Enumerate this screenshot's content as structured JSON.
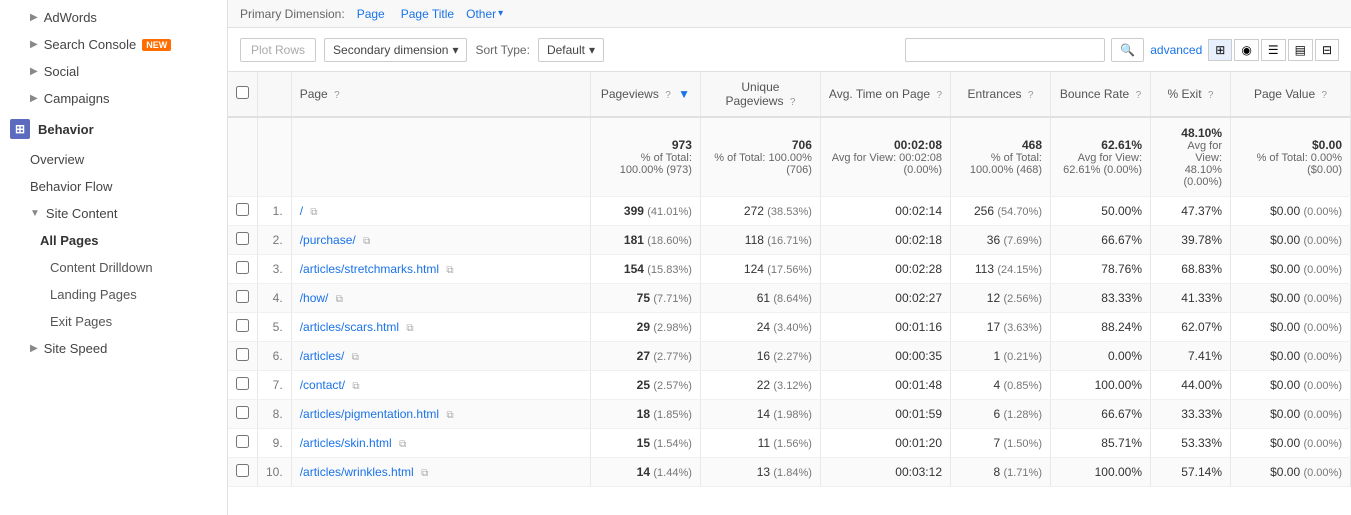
{
  "sidebar": {
    "items": [
      {
        "id": "adwords",
        "label": "AdWords",
        "arrow": "▶",
        "indent": 1
      },
      {
        "id": "search-console",
        "label": "Search Console",
        "badge": "NEW",
        "arrow": "▶",
        "indent": 1
      },
      {
        "id": "social",
        "label": "Social",
        "arrow": "▶",
        "indent": 1
      },
      {
        "id": "campaigns",
        "label": "Campaigns",
        "arrow": "▶",
        "indent": 1
      },
      {
        "id": "behavior",
        "label": "Behavior",
        "isSection": true
      },
      {
        "id": "overview",
        "label": "Overview",
        "indent": 1
      },
      {
        "id": "behavior-flow",
        "label": "Behavior Flow",
        "indent": 1
      },
      {
        "id": "site-content",
        "label": "Site Content",
        "arrow": "▼",
        "indent": 1
      },
      {
        "id": "all-pages",
        "label": "All Pages",
        "indent": 2,
        "active": true
      },
      {
        "id": "content-drilldown",
        "label": "Content Drilldown",
        "indent": 3
      },
      {
        "id": "landing-pages",
        "label": "Landing Pages",
        "indent": 3
      },
      {
        "id": "exit-pages",
        "label": "Exit Pages",
        "indent": 3
      },
      {
        "id": "site-speed",
        "label": "Site Speed",
        "arrow": "▶",
        "indent": 1
      }
    ]
  },
  "dimension_bar": {
    "label": "Primary Dimension:",
    "tabs": [
      {
        "id": "page",
        "label": "Page",
        "active": true
      },
      {
        "id": "page-title",
        "label": "Page Title"
      },
      {
        "id": "other",
        "label": "Other",
        "hasDropdown": true
      }
    ]
  },
  "toolbar": {
    "plot_rows_label": "Plot Rows",
    "secondary_dim_label": "Secondary dimension",
    "sort_type_label": "Sort Type:",
    "sort_default_label": "Default",
    "search_placeholder": "",
    "advanced_label": "advanced"
  },
  "summary": {
    "pageviews": "973",
    "pageviews_pct": "% of Total: 100.00% (973)",
    "unique_pageviews": "706",
    "unique_pct": "% of Total: 100.00% (706)",
    "avg_time": "00:02:08",
    "avg_time_sub": "Avg for View: 00:02:08 (0.00%)",
    "entrances": "468",
    "entrances_pct": "% of Total: 100.00% (468)",
    "bounce_rate": "62.61%",
    "bounce_sub": "Avg for View: 62.61% (0.00%)",
    "exit_pct": "48.10%",
    "exit_sub": "Avg for View: 48.10% (0.00%)",
    "page_value": "$0.00",
    "page_value_sub": "% of Total: 0.00% ($0.00)"
  },
  "table": {
    "headers": [
      {
        "id": "checkbox",
        "label": ""
      },
      {
        "id": "num",
        "label": ""
      },
      {
        "id": "page",
        "label": "Page"
      },
      {
        "id": "pageviews",
        "label": "Pageviews",
        "help": true,
        "sort": true
      },
      {
        "id": "unique-pageviews",
        "label": "Unique Pageviews",
        "help": true
      },
      {
        "id": "avg-time",
        "label": "Avg. Time on Page",
        "help": true
      },
      {
        "id": "entrances",
        "label": "Entrances",
        "help": true
      },
      {
        "id": "bounce-rate",
        "label": "Bounce Rate",
        "help": true
      },
      {
        "id": "exit",
        "label": "% Exit",
        "help": true
      },
      {
        "id": "page-value",
        "label": "Page Value",
        "help": true
      }
    ],
    "rows": [
      {
        "num": 1,
        "page": "/",
        "pageviews": "399",
        "pv_pct": "(41.01%)",
        "upv": "272",
        "upv_pct": "(38.53%)",
        "time": "00:02:14",
        "entrances": "256",
        "ent_pct": "(54.70%)",
        "bounce": "50.00%",
        "exit": "47.37%",
        "value": "$0.00",
        "val_pct": "(0.00%)"
      },
      {
        "num": 2,
        "page": "/purchase/",
        "pageviews": "181",
        "pv_pct": "(18.60%)",
        "upv": "118",
        "upv_pct": "(16.71%)",
        "time": "00:02:18",
        "entrances": "36",
        "ent_pct": "(7.69%)",
        "bounce": "66.67%",
        "exit": "39.78%",
        "value": "$0.00",
        "val_pct": "(0.00%)"
      },
      {
        "num": 3,
        "page": "/articles/stretchmarks.html",
        "pageviews": "154",
        "pv_pct": "(15.83%)",
        "upv": "124",
        "upv_pct": "(17.56%)",
        "time": "00:02:28",
        "entrances": "113",
        "ent_pct": "(24.15%)",
        "bounce": "78.76%",
        "exit": "68.83%",
        "value": "$0.00",
        "val_pct": "(0.00%)"
      },
      {
        "num": 4,
        "page": "/how/",
        "pageviews": "75",
        "pv_pct": "(7.71%)",
        "upv": "61",
        "upv_pct": "(8.64%)",
        "time": "00:02:27",
        "entrances": "12",
        "ent_pct": "(2.56%)",
        "bounce": "83.33%",
        "exit": "41.33%",
        "value": "$0.00",
        "val_pct": "(0.00%)"
      },
      {
        "num": 5,
        "page": "/articles/scars.html",
        "pageviews": "29",
        "pv_pct": "(2.98%)",
        "upv": "24",
        "upv_pct": "(3.40%)",
        "time": "00:01:16",
        "entrances": "17",
        "ent_pct": "(3.63%)",
        "bounce": "88.24%",
        "exit": "62.07%",
        "value": "$0.00",
        "val_pct": "(0.00%)"
      },
      {
        "num": 6,
        "page": "/articles/",
        "pageviews": "27",
        "pv_pct": "(2.77%)",
        "upv": "16",
        "upv_pct": "(2.27%)",
        "time": "00:00:35",
        "entrances": "1",
        "ent_pct": "(0.21%)",
        "bounce": "0.00%",
        "exit": "7.41%",
        "value": "$0.00",
        "val_pct": "(0.00%)"
      },
      {
        "num": 7,
        "page": "/contact/",
        "pageviews": "25",
        "pv_pct": "(2.57%)",
        "upv": "22",
        "upv_pct": "(3.12%)",
        "time": "00:01:48",
        "entrances": "4",
        "ent_pct": "(0.85%)",
        "bounce": "100.00%",
        "exit": "44.00%",
        "value": "$0.00",
        "val_pct": "(0.00%)"
      },
      {
        "num": 8,
        "page": "/articles/pigmentation.html",
        "pageviews": "18",
        "pv_pct": "(1.85%)",
        "upv": "14",
        "upv_pct": "(1.98%)",
        "time": "00:01:59",
        "entrances": "6",
        "ent_pct": "(1.28%)",
        "bounce": "66.67%",
        "exit": "33.33%",
        "value": "$0.00",
        "val_pct": "(0.00%)"
      },
      {
        "num": 9,
        "page": "/articles/skin.html",
        "pageviews": "15",
        "pv_pct": "(1.54%)",
        "upv": "11",
        "upv_pct": "(1.56%)",
        "time": "00:01:20",
        "entrances": "7",
        "ent_pct": "(1.50%)",
        "bounce": "85.71%",
        "exit": "53.33%",
        "value": "$0.00",
        "val_pct": "(0.00%)"
      },
      {
        "num": 10,
        "page": "/articles/wrinkles.html",
        "pageviews": "14",
        "pv_pct": "(1.44%)",
        "upv": "13",
        "upv_pct": "(1.84%)",
        "time": "00:03:12",
        "entrances": "8",
        "ent_pct": "(1.71%)",
        "bounce": "100.00%",
        "exit": "57.14%",
        "value": "$0.00",
        "val_pct": "(0.00%)"
      }
    ]
  },
  "colors": {
    "link": "#1a73e8",
    "header_bg": "#f8f8f8",
    "border": "#e0e0e0",
    "accent": "#5c6bc0"
  }
}
